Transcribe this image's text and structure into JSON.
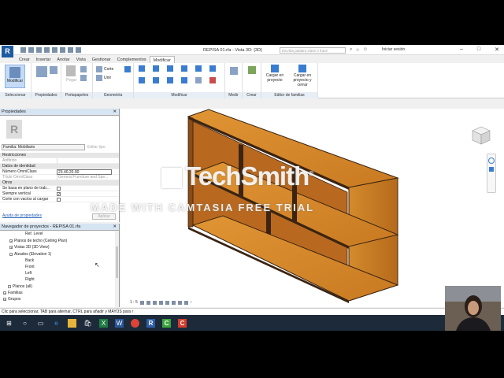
{
  "app": {
    "logo": "R",
    "title": "REPISA 01.rfa - Vista 3D: {3D}",
    "search_placeholder": "Escriba palabra clave o frase",
    "login": "Iniciar sesión"
  },
  "window_controls": [
    "–",
    "□",
    "✕"
  ],
  "ribbon_tabs": [
    "Crear",
    "Insertar",
    "Anotar",
    "Vista",
    "Gestionar",
    "Complementos",
    "Modificar"
  ],
  "active_tab": "Modificar",
  "ribbon": {
    "modify_btn": "Modificar",
    "propiedades_btn": "Propiedades",
    "pegar_btn": "Pegar",
    "corte": "Corte",
    "unir": "Unir",
    "cargar_proyecto": "Cargar en proyecto",
    "cargar_cerrar": "Cargar en proyecto y cerrar",
    "groups": {
      "seleccionar": "Seleccionar",
      "propiedades": "Propiedades",
      "portapapeles": "Portapapeles",
      "geometria": "Geometría",
      "modificar": "Modificar",
      "medir": "Medir",
      "crear": "Crear",
      "editor": "Editor de familias"
    }
  },
  "properties": {
    "title": "Propiedades",
    "close": "✕",
    "logo": "R",
    "family": "Familia: Mobiliario",
    "edit_type": "Editar tipo",
    "sections": {
      "restricciones": "Restricciones",
      "anfitrion": "Anfitrión",
      "datos": "Datos de identidad",
      "numero_label": "Número OmniClass",
      "numero_value": "23.40.20.00",
      "titulo_label": "Título OmniClass",
      "titulo_value": "General Furniture and Spe...",
      "otros": "Otros",
      "plano": "Se basa en plano de trab...",
      "vertical": "Siempre vertical",
      "corte": "Corte con vacíos al cargar"
    },
    "help_link": "Ayuda de propiedades",
    "apply": "Aplicar"
  },
  "navigator": {
    "title": "Navegador de proyectos - REPISA 01.rfa",
    "close": "✕",
    "items": [
      {
        "label": "Ref. Level",
        "expander": ""
      },
      {
        "label": "Planos de techo (Ceiling Plan)",
        "expander": "+"
      },
      {
        "label": "Vistas 3D (3D View)",
        "expander": "+"
      },
      {
        "label": "Alzados (Elevation 1)",
        "expander": "-"
      },
      {
        "label": "Back",
        "expander": ""
      },
      {
        "label": "Front",
        "expander": ""
      },
      {
        "label": "Left",
        "expander": ""
      },
      {
        "label": "Right",
        "expander": ""
      },
      {
        "label": "Planos (all)",
        "expander": ""
      },
      {
        "label": "Familias",
        "expander": "+"
      },
      {
        "label": "Grupos",
        "expander": "+"
      }
    ]
  },
  "view": {
    "scale": "1 : 5",
    "viewcube_face": "",
    "watermark_brand": "TechSmith",
    "watermark_text": "MADE WITH CAMTASIA FREE TRIAL"
  },
  "status": {
    "text": "Clic para seleccionar, TAB para alternar, CTRL para añadir y MAYÚS para r"
  },
  "colors": {
    "wood_top": "#d98a2b",
    "wood_side": "#c4751f",
    "wood_edge": "#3b2412",
    "accent": "#1e5aa0"
  }
}
